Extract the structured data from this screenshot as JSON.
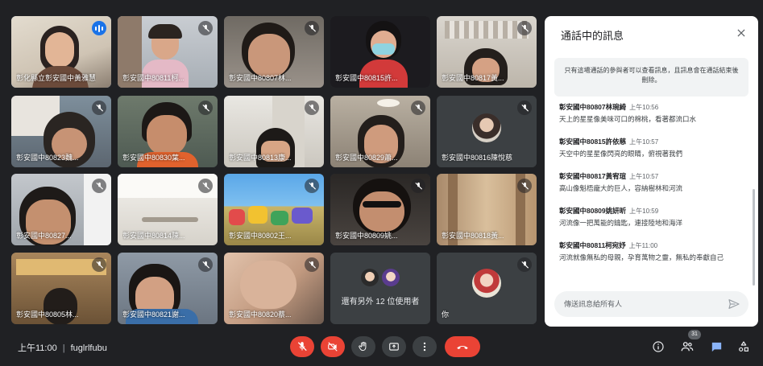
{
  "participants": [
    {
      "name": "彰化縣立彰安國中黃雅慧",
      "speaking": true
    },
    {
      "name": "彰安國中80811柯..."
    },
    {
      "name": "彰安國中80807林..."
    },
    {
      "name": "彰安國中80815許..."
    },
    {
      "name": "彰安國中80817黃..."
    },
    {
      "name": "彰安國中80823魏..."
    },
    {
      "name": "彰安國中80830葉..."
    },
    {
      "name": "彰安國中80813康..."
    },
    {
      "name": "彰安國中80829蕭..."
    },
    {
      "name": "彰安國中80816陳悅慈"
    },
    {
      "name": "彰安國中80827..."
    },
    {
      "name": "彰安國中80814陳..."
    },
    {
      "name": "彰安國中80802王..."
    },
    {
      "name": "彰安國中80809姚..."
    },
    {
      "name": "彰安國中80818黃..."
    },
    {
      "name": "彰安國中80805林..."
    },
    {
      "name": "彰安國中80821謝..."
    },
    {
      "name": "彰安國中80820蔡..."
    }
  ],
  "others_tile": {
    "text": "還有另外 12 位使用者"
  },
  "self_tile": {
    "name": "你"
  },
  "chat": {
    "title": "通話中的訊息",
    "notice": "只有這場通話的參與者可以查看訊息，且訊息會在通話結束後刪除。",
    "messages": [
      {
        "sender": "彰安國中80807林琬綺",
        "time": "上午10:56",
        "text": "天上的星星像美味可口的棉桃，看著都流口水"
      },
      {
        "sender": "彰安國中80815許依慈",
        "time": "上午10:57",
        "text": "天空中的星星像閃亮的眼睛，俯視著我們"
      },
      {
        "sender": "彰安國中80817黃宥瑄",
        "time": "上午10:57",
        "text": "高山像魁梧龐大的巨人，容納樹林和河流"
      },
      {
        "sender": "彰安國中80809姚妍昕",
        "time": "上午10:59",
        "text": "河流像一把萬能的鑰匙，連接陸地和海洋"
      },
      {
        "sender": "彰安國中80811柯宛妤",
        "time": "上午11:00",
        "text": "河流就像無私的母親，孕育萬物之靈，無私的奉獻自己"
      }
    ],
    "input_placeholder": "傳送訊息給所有人"
  },
  "footer": {
    "time": "上午11:00",
    "separator": "|",
    "meeting_code": "fuglrlfubu",
    "participant_count": "31"
  },
  "colors": {
    "background": "#202124",
    "tile": "#3c4043",
    "accent": "#1a73e8",
    "hangup": "#ea4335",
    "chat_icon": "#8ab4f8"
  }
}
